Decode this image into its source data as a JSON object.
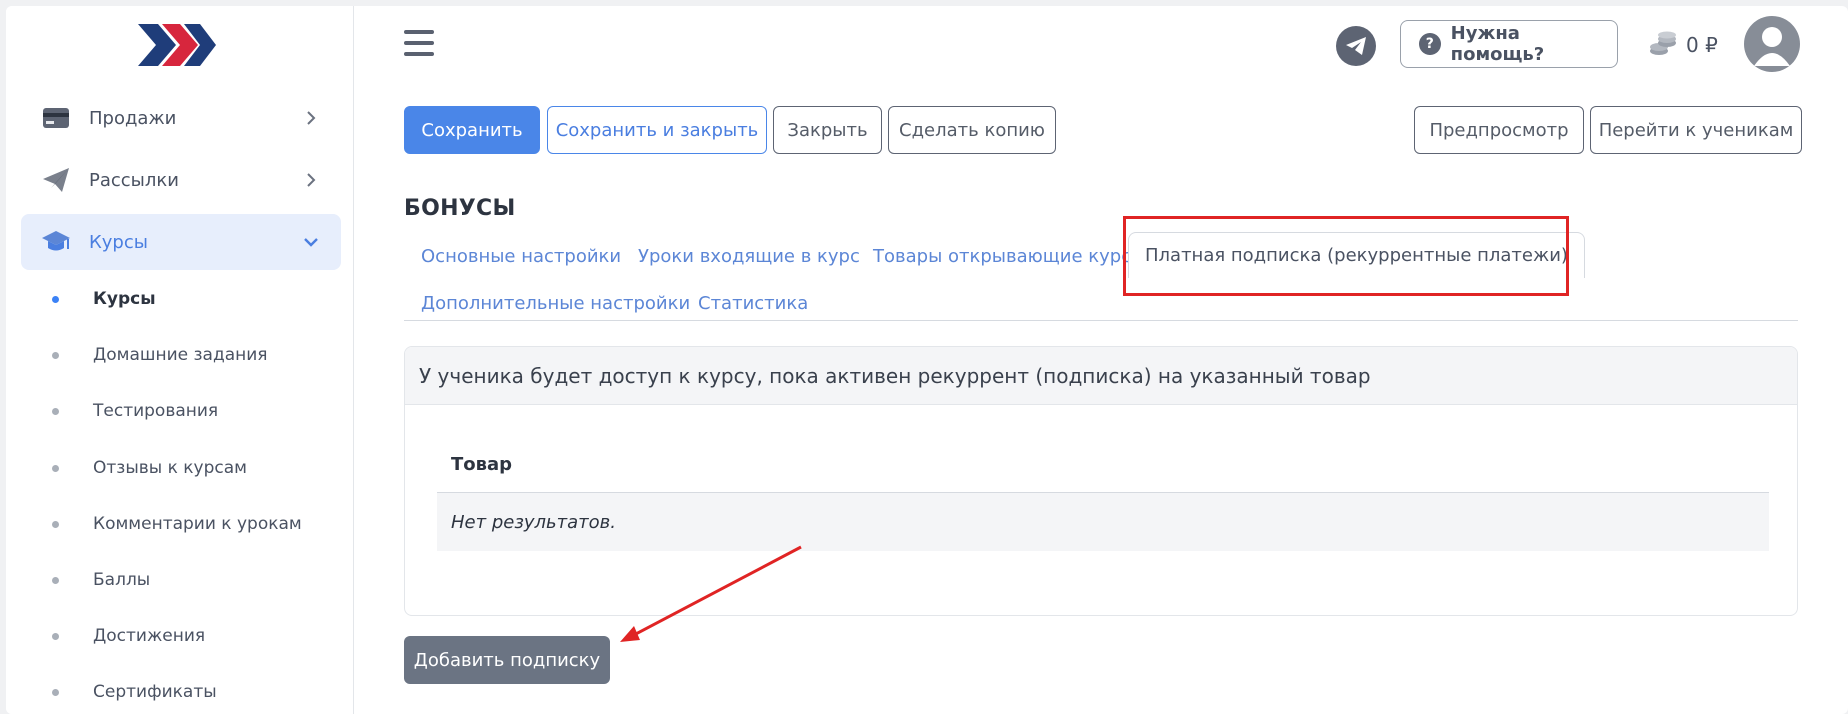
{
  "sidebar": {
    "logo": "brand-chevrons-logo",
    "items": [
      {
        "label": "Продажи",
        "icon": "credit-card-icon"
      },
      {
        "label": "Рассылки",
        "icon": "paper-plane-icon"
      },
      {
        "label": "Курсы",
        "icon": "graduation-cap-icon"
      }
    ],
    "sub_items": [
      {
        "label": "Курсы"
      },
      {
        "label": "Домашние задания"
      },
      {
        "label": "Тестирования"
      },
      {
        "label": "Отзывы к курсам"
      },
      {
        "label": "Комментарии к урокам"
      },
      {
        "label": "Баллы"
      },
      {
        "label": "Достижения"
      },
      {
        "label": "Сертификаты"
      }
    ]
  },
  "header": {
    "help_label": "Нужна помощь?",
    "help_icon": "question-circle-icon",
    "balance": "0 ₽",
    "telegram_icon": "telegram-icon",
    "avatar_icon": "user-avatar-icon"
  },
  "toolbar": {
    "save": "Сохранить",
    "save_close": "Сохранить и закрыть",
    "close": "Закрыть",
    "copy": "Сделать копию",
    "preview": "Предпросмотр",
    "students": "Перейти к ученикам"
  },
  "page": {
    "title": "БОНУСЫ"
  },
  "tabs": [
    {
      "label": "Основные настройки"
    },
    {
      "label": "Уроки входящие в курс"
    },
    {
      "label": "Товары открывающие курс"
    },
    {
      "label": "Платная подписка (рекуррентные платежи)"
    },
    {
      "label": "Дополнительные настройки"
    },
    {
      "label": "Статистика"
    }
  ],
  "card": {
    "header": "У ученика будет доступ к курсу, пока активен рекуррент (подписка) на указанный товар",
    "column": "Товар",
    "empty": "Нет результатов."
  },
  "actions": {
    "add_subscription": "Добавить подписку"
  },
  "colors": {
    "primary": "#4a86e8",
    "highlight": "#e02424",
    "sidebar_active_bg": "#e7eefc"
  }
}
